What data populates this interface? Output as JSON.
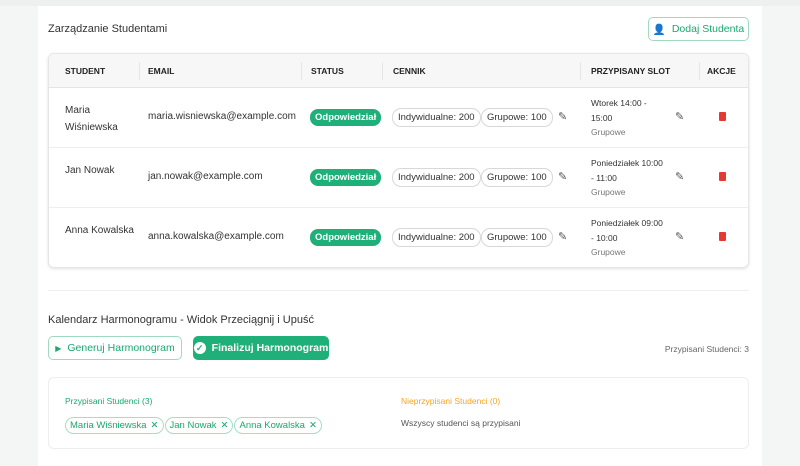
{
  "students_section": {
    "title": "Zarządzanie Studentami",
    "add_button": "Dodaj Studenta",
    "add_icon": "person-add-icon"
  },
  "table": {
    "headers": [
      "STUDENT",
      "EMAIL",
      "STATUS",
      "CENNIK",
      "PRZYPISANY SLOT",
      "AKCJE"
    ],
    "rows": [
      {
        "name": "Maria Wiśniewska",
        "email": "maria.wisniewska@example.com",
        "status": "Odpowiedział",
        "price_individual": "Indywidualne: 200",
        "price_group": "Grupowe: 100",
        "slot": "Wtorek 14:00 - 15:00",
        "slot_type": "Grupowe"
      },
      {
        "name": "Jan Nowak",
        "email": "jan.nowak@example.com",
        "status": "Odpowiedział",
        "price_individual": "Indywidualne: 200",
        "price_group": "Grupowe: 100",
        "slot": "Poniedziałek 10:00 - 11:00",
        "slot_type": "Grupowe"
      },
      {
        "name": "Anna Kowalska",
        "email": "anna.kowalska@example.com",
        "status": "Odpowiedział",
        "price_individual": "Indywidualne: 200",
        "price_group": "Grupowe: 100",
        "slot": "Poniedziałek 09:00 - 10:00",
        "slot_type": "Grupowe"
      }
    ]
  },
  "calendar": {
    "title": "Kalendarz Harmonogramu - Widok Przeciągnij i Upuść",
    "generate_button": "Generuj Harmonogram",
    "finalize_button": "Finalizuj Harmonogram",
    "assigned_count": "Przypisani Studenci: 3",
    "assigned_title": "Przypisani Studenci (3)",
    "assigned": [
      "Maria Wiśniewska",
      "Jan Nowak",
      "Anna Kowalska"
    ],
    "unassigned_title": "Nieprzypisani Studenci (0)",
    "unassigned_empty": "Wszyscy studenci są przypisani"
  },
  "colors": {
    "accent": "#1fb07a",
    "warning": "#f5a623",
    "delete": "#e53935"
  }
}
